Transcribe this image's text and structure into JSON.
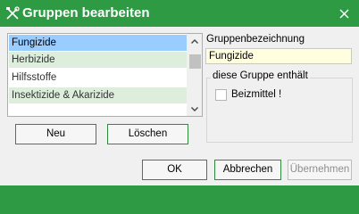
{
  "window": {
    "title": "Gruppen bearbeiten",
    "title_icon": "crossed-tools-icon",
    "close_icon": "close-icon",
    "accent_color": "#2e9a44"
  },
  "group_list": {
    "items": [
      {
        "label": "Fungizide",
        "selected": true
      },
      {
        "label": "Herbizide",
        "selected": false
      },
      {
        "label": "Hilfsstoffe",
        "selected": false
      },
      {
        "label": "Insektizide & Akarizide",
        "selected": false
      }
    ],
    "scroll_up_icon": "chevron-up-icon",
    "scroll_down_icon": "chevron-down-icon"
  },
  "list_buttons": {
    "new_label": "Neu",
    "delete_label": "Löschen"
  },
  "details": {
    "name_label": "Gruppenbezeichnung",
    "name_value": "Fungizide",
    "contains_legend": "diese Gruppe enthält",
    "pesticide_label": "Beizmittel !",
    "pesticide_checked": false
  },
  "footer": {
    "ok_label": "OK",
    "cancel_label": "Abbrechen",
    "apply_label": "Übernehmen",
    "apply_enabled": false
  }
}
